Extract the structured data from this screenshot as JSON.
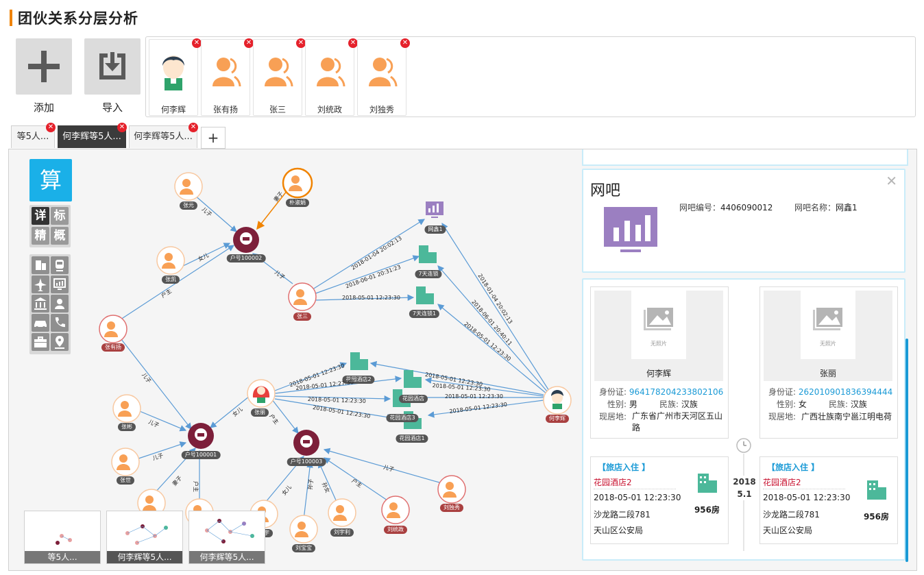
{
  "page": {
    "title": "团伙关系分层分析"
  },
  "toolbar": {
    "add_label": "添加",
    "import_label": "导入"
  },
  "people": [
    {
      "name": "何李辉",
      "type": "male"
    },
    {
      "name": "张有扬",
      "type": "generic"
    },
    {
      "name": "张三",
      "type": "generic"
    },
    {
      "name": "刘统政",
      "type": "generic"
    },
    {
      "name": "刘独秀",
      "type": "generic"
    }
  ],
  "tabs": [
    {
      "label": "等5人..."
    },
    {
      "label": "何李辉等5人..."
    },
    {
      "label": "何李辉等5人..."
    }
  ],
  "tab_add": "+",
  "sidebar": {
    "calc": "算",
    "modes": [
      "详",
      "标",
      "精",
      "概"
    ]
  },
  "graph": {
    "nodes": {
      "zhangyuan": "张元",
      "piaowi": "朴淑娟",
      "zhangkai": "张凯",
      "hu2": "户号100002",
      "wangba1": "网鑫1",
      "qitian1": "7天连锁",
      "qitian2": "7天连锁1",
      "zhangsan": "张三",
      "zhangyouyang": "张有扬",
      "zhangbin": "张彬",
      "zhangshi": "张世",
      "hu1": "户号100001",
      "zhangli": "张丽",
      "hu3": "户号100003",
      "huayuan2": "花园酒店2",
      "huayuan": "花园酒店",
      "huayuan3": "花园酒店3",
      "huayuan1": "花园酒店1",
      "helihui": "何李辉",
      "liuduxiu": "刘独秀",
      "liutongzheng": "刘统政",
      "liuyu": "刘宇",
      "liubaobao": "刘宝宝",
      "liuyuli": "刘宇利"
    },
    "edges": {
      "e1": "儿子",
      "e2": "妻子",
      "e3": "女儿",
      "e4": "户主",
      "e5": "儿子",
      "e6": "2018-01-04 20:02:13",
      "e7": "2018-06-01 20:31:23",
      "e8": "2018-05-01 12:23:30",
      "e9": "2018-01-04 20:02:13",
      "e10": "2018-06-01 20:40:11",
      "e11": "2018-05-01 12:23:30",
      "e12": "儿子",
      "e13": "儿子",
      "e14": "儿子",
      "e15": "妻子",
      "e16": "户主",
      "e17": "女儿",
      "e18": "户主",
      "e19": "2018-05-01 12:23:30",
      "e20": "2018-05-01 12:27:30",
      "e21": "2018-05-01 12:23:30",
      "e22": "2018-05-01 12:23:30",
      "e23": "2018-05-01 12:23:30",
      "e24": "2018-05-01 12:23:30",
      "e25": "2018-05-01 12:23:30",
      "e26": "2018-05-01 12:23:30",
      "e27": "女儿",
      "e28": "孙子",
      "e29": "孙女",
      "e30": "户主",
      "e31": "儿子"
    }
  },
  "thumbnails": [
    {
      "label": "等5人..."
    },
    {
      "label": "何李辉等5人..."
    },
    {
      "label": "何李辉等5人..."
    }
  ],
  "detail": {
    "wangba": {
      "title": "网吧",
      "id_label": "网吧编号：",
      "id_value": "4406090012",
      "name_label": "网吧名称：",
      "name_value": "网鑫1"
    },
    "persons": [
      {
        "no_photo": "无照片",
        "name": "何李辉",
        "id_label": "身份证:",
        "id_value": "964178204233802106",
        "gender_label": "性别:",
        "gender_value": "男",
        "ethnic_label": "民族:",
        "ethnic_value": "汉族",
        "addr_label": "现居地:",
        "addr_value": "广东省广州市天河区五山路"
      },
      {
        "no_photo": "无照片",
        "name": "张丽",
        "id_label": "身份证:",
        "id_value": "262010901836394444",
        "gender_label": "性别:",
        "gender_value": "女",
        "ethnic_label": "民族:",
        "ethnic_value": "汉族",
        "addr_label": "现居地:",
        "addr_value": "广西壮族南宁邕江明电荷"
      }
    ],
    "timeline": {
      "year": "2018",
      "date": "5.1"
    },
    "stays": [
      {
        "tag": "【旅店入住 】",
        "hotel": "花园酒店2",
        "time": "2018-05-01 12:23:30",
        "addr1": "沙龙路二段781",
        "addr2": "天山区公安局",
        "room": "956房"
      },
      {
        "tag": "【旅店入住 】",
        "hotel": "花园酒店2",
        "time": "2018-05-01 12:23:30",
        "addr1": "沙龙路二段781",
        "addr2": "天山区公安局",
        "room": "956房"
      }
    ]
  },
  "colors": {
    "accent": "#f08300",
    "calc": "#1ab0e8",
    "household": "#7d1f3a",
    "hotel": "#4cb89a",
    "netbar": "#9b7fc1",
    "edge": "#5b9bd5",
    "link_blue": "#1a9ad6"
  }
}
